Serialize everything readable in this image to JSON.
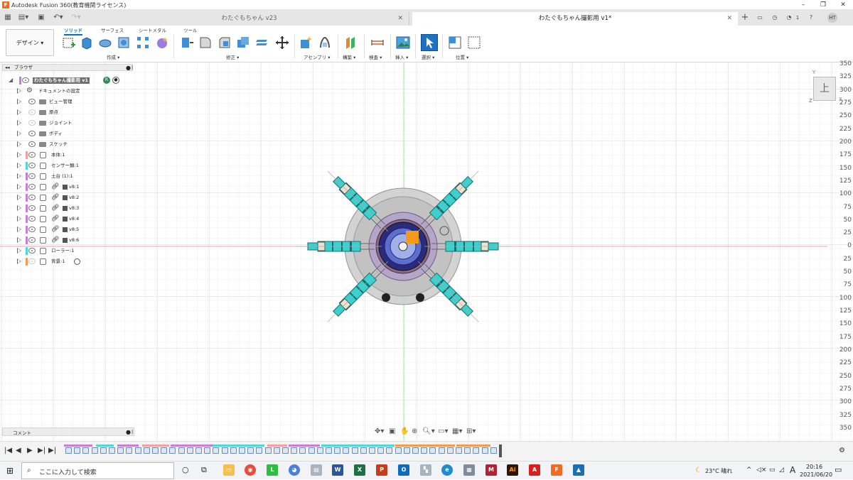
{
  "window": {
    "title": "Autodesk Fusion 360(教育機関ライセンス)"
  },
  "tabs": [
    {
      "label": "わたぐもちゃん v23",
      "active": false
    },
    {
      "label": "わたぐもちゃん撮影用 v1*",
      "active": true
    }
  ],
  "header_right": {
    "notification_count": "1",
    "user_initials": "HT"
  },
  "ribbon": {
    "workspace": "デザイン ▾",
    "tabs": [
      "ソリッド",
      "サーフェス",
      "シートメタル",
      "ツール"
    ],
    "groups": [
      "作成 ▾",
      "修正 ▾",
      "アセンブリ ▾",
      "構築 ▾",
      "検査 ▾",
      "挿入 ▾",
      "選択 ▾",
      "位置 ▾"
    ]
  },
  "browser": {
    "title": "ブラウザ",
    "root": "わたぐもちゃん撮影用 v1",
    "items": [
      {
        "label": "ドキュメントの設定",
        "type": "settings",
        "visible": true,
        "color": ""
      },
      {
        "label": "ビュー管理",
        "type": "folder",
        "visible": true,
        "color": ""
      },
      {
        "label": "原点",
        "type": "folder",
        "visible": false,
        "color": ""
      },
      {
        "label": "ジョイント",
        "type": "folder",
        "visible": false,
        "color": ""
      },
      {
        "label": "ボディ",
        "type": "folder",
        "visible": true,
        "color": ""
      },
      {
        "label": "スケッチ",
        "type": "folder",
        "visible": true,
        "color": ""
      },
      {
        "label": "本体:1",
        "type": "component",
        "visible": true,
        "color": "#f4a0a0"
      },
      {
        "label": "センサー類:1",
        "type": "component",
        "visible": true,
        "color": "#4fd6d6"
      },
      {
        "label": "土台 (1):1",
        "type": "component",
        "visible": true,
        "color": "#c77ddb"
      },
      {
        "label": "v8:1",
        "type": "linked",
        "visible": true,
        "color": "#c77ddb"
      },
      {
        "label": "v8:2",
        "type": "linked",
        "visible": true,
        "color": "#c77ddb"
      },
      {
        "label": "v8:3",
        "type": "linked",
        "visible": true,
        "color": "#c77ddb"
      },
      {
        "label": "v8:4",
        "type": "linked",
        "visible": true,
        "color": "#c77ddb"
      },
      {
        "label": "v8:5",
        "type": "linked",
        "visible": true,
        "color": "#c77ddb"
      },
      {
        "label": "v8:6",
        "type": "linked",
        "visible": true,
        "color": "#c77ddb"
      },
      {
        "label": "ローラー:1",
        "type": "component",
        "visible": true,
        "color": "#4fd6d6"
      },
      {
        "label": "背景:1",
        "type": "component",
        "visible": false,
        "color": "#f29b4b"
      }
    ]
  },
  "comment_panel": {
    "title": "コメント"
  },
  "ruler": [
    "350",
    "325",
    "300",
    "275",
    "250",
    "225",
    "200",
    "175",
    "150",
    "125",
    "100",
    "75",
    "50",
    "25",
    "0",
    "25",
    "50",
    "75",
    "100",
    "125",
    "150",
    "175",
    "200",
    "225",
    "250",
    "275",
    "300",
    "325",
    "350"
  ],
  "viewcube": {
    "face": "上",
    "axis_y": "Y",
    "axis_x": "X",
    "axis_z": "Z"
  },
  "taskbar": {
    "search_placeholder": "ここに入力して検索",
    "weather": "23°C 晴れ",
    "ime": "A",
    "time": "20:16",
    "date": "2021/06/20"
  }
}
